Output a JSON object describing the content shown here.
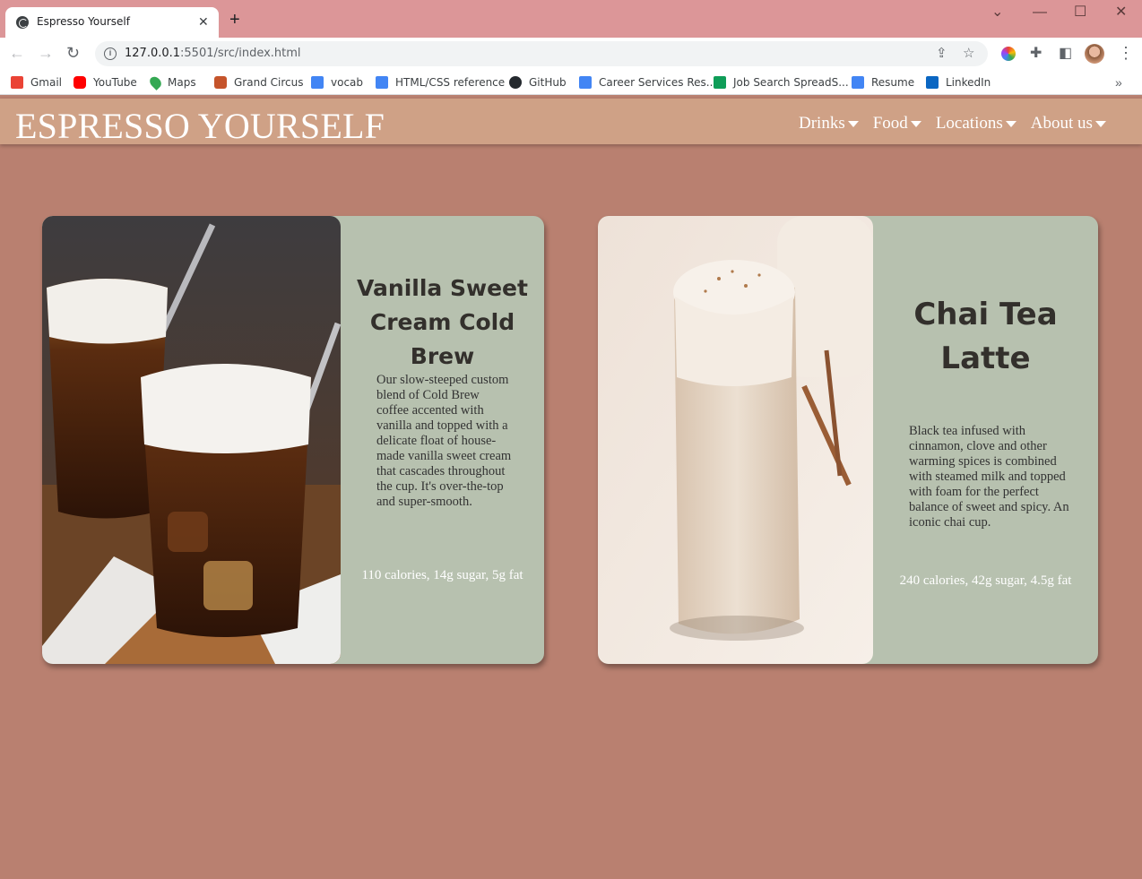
{
  "browser": {
    "tab_title": "Espresso Yourself",
    "tab_close": "✕",
    "new_tab": "+",
    "window_controls": {
      "dropdown": "⌄",
      "minimize": "—",
      "maximize": "☐",
      "close": "✕"
    },
    "nav": {
      "back": "←",
      "forward": "→",
      "reload": "↻"
    },
    "url_host": "127.0.0.1",
    "url_rest": ":5501/src/index.html",
    "bookmarks": [
      {
        "label": "Gmail",
        "icon": "gmail-icon",
        "color": "#ea4335"
      },
      {
        "label": "YouTube",
        "icon": "youtube-icon",
        "color": "#ff0000"
      },
      {
        "label": "Maps",
        "icon": "maps-icon",
        "color": "#34a853"
      },
      {
        "label": "Grand Circus",
        "icon": "grand-circus-icon",
        "color": "#c5542b"
      },
      {
        "label": "vocab",
        "icon": "docs-icon",
        "color": "#4285f4"
      },
      {
        "label": "HTML/CSS reference",
        "icon": "docs-icon",
        "color": "#4285f4"
      },
      {
        "label": "GitHub",
        "icon": "github-icon",
        "color": "#24292e"
      },
      {
        "label": "Career Services Res...",
        "icon": "docs-icon",
        "color": "#4285f4"
      },
      {
        "label": "Job Search SpreadS...",
        "icon": "sheets-icon",
        "color": "#0f9d58"
      },
      {
        "label": "Resume",
        "icon": "docs-icon",
        "color": "#4285f4"
      },
      {
        "label": "LinkedIn",
        "icon": "linkedin-icon",
        "color": "#0a66c2"
      }
    ],
    "bookmarks_more": "»"
  },
  "site": {
    "title": "ESPRESSO YOURSELF",
    "nav": [
      {
        "label": "Drinks"
      },
      {
        "label": "Food"
      },
      {
        "label": "Locations"
      },
      {
        "label": "About us"
      }
    ],
    "colors": {
      "page_bg": "#b98070",
      "header_bg": "#cfa186",
      "card_bg": "#b7c1af"
    }
  },
  "cards": [
    {
      "title": "Vanilla Sweet Cream Cold Brew",
      "description": "Our slow-steeped custom blend of Cold Brew coffee accented with vanilla and topped with a delicate float of house-made vanilla sweet cream that cascades throughout the cup. It's over-the-top and super-smooth.",
      "nutrition": "110 calories, 14g sugar, 5g fat"
    },
    {
      "title": "Chai Tea Latte",
      "description": "Black tea infused with cinnamon, clove and other warming spices is combined with steamed milk and topped with foam for the perfect balance of sweet and spicy. An iconic chai cup.",
      "nutrition": "240 calories, 42g sugar, 4.5g fat"
    }
  ]
}
